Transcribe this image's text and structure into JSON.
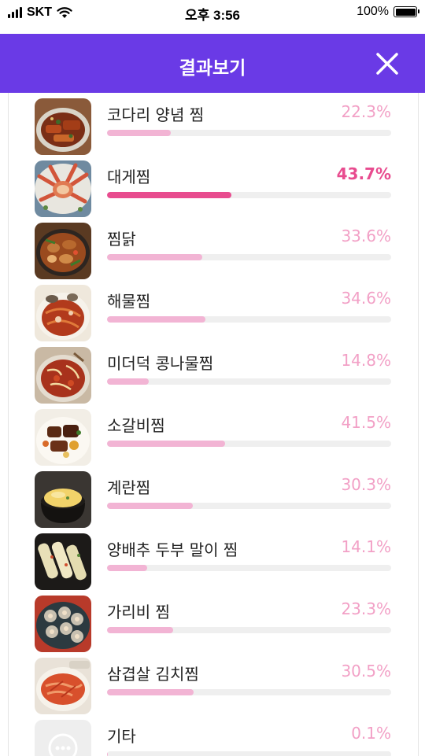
{
  "status_bar": {
    "carrier": "SKT",
    "time": "오후 3:56",
    "battery": "100%"
  },
  "header": {
    "title": "결과보기",
    "close_icon": "close-icon"
  },
  "results": [
    {
      "label": "코다리 양념 찜",
      "percent": "22.3%",
      "value": 22.3,
      "highlight": false,
      "image": "braised-pollack-photo"
    },
    {
      "label": "대게찜",
      "percent": "43.7%",
      "value": 43.7,
      "highlight": true,
      "image": "steamed-snow-crab-photo"
    },
    {
      "label": "찜닭",
      "percent": "33.6%",
      "value": 33.6,
      "highlight": false,
      "image": "braised-chicken-photo"
    },
    {
      "label": "해물찜",
      "percent": "34.6%",
      "value": 34.6,
      "highlight": false,
      "image": "seafood-jjim-photo"
    },
    {
      "label": "미더덕 콩나물찜",
      "percent": "14.8%",
      "value": 14.8,
      "highlight": false,
      "image": "sea-squirt-sprout-photo"
    },
    {
      "label": "소갈비찜",
      "percent": "41.5%",
      "value": 41.5,
      "highlight": false,
      "image": "braised-short-ribs-photo"
    },
    {
      "label": "계란찜",
      "percent": "30.3%",
      "value": 30.3,
      "highlight": false,
      "image": "steamed-egg-photo"
    },
    {
      "label": "양배추 두부 말이 찜",
      "percent": "14.1%",
      "value": 14.1,
      "highlight": false,
      "image": "cabbage-tofu-roll-photo"
    },
    {
      "label": "가리비 찜",
      "percent": "23.3%",
      "value": 23.3,
      "highlight": false,
      "image": "steamed-scallop-photo"
    },
    {
      "label": "삼겹살 김치찜",
      "percent": "30.5%",
      "value": 30.5,
      "highlight": false,
      "image": "pork-belly-kimchi-photo"
    },
    {
      "label": "기타",
      "percent": "0.1%",
      "value": 0.1,
      "highlight": false,
      "image": "more-icon"
    }
  ],
  "colors": {
    "header": "#6a3ae6",
    "bar_fill": "#f2b4d4",
    "bar_highlight": "#e84c8f",
    "percent_text": "#f2a0c6",
    "bar_track": "#efefef"
  }
}
